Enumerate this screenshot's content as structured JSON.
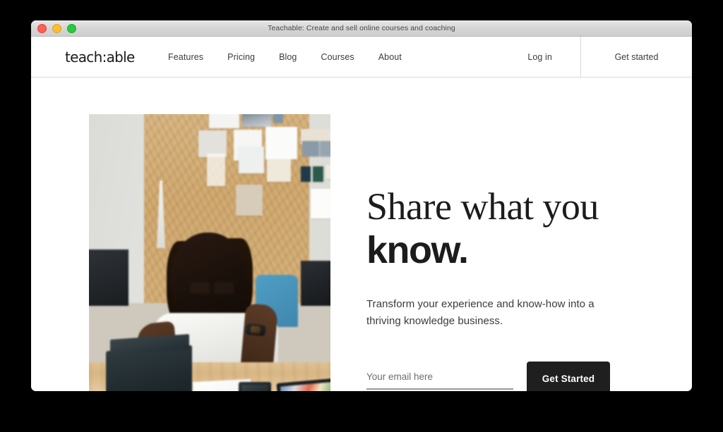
{
  "window": {
    "title": "Teachable: Create and sell online courses and coaching",
    "controls": {
      "close": "close-button",
      "minimize": "minimize-button",
      "maximize": "maximize-button"
    }
  },
  "header": {
    "logo": "teach:able",
    "nav": [
      {
        "label": "Features"
      },
      {
        "label": "Pricing"
      },
      {
        "label": "Blog"
      },
      {
        "label": "Courses"
      },
      {
        "label": "About"
      }
    ],
    "login_label": "Log in",
    "cta_label": "Get started"
  },
  "hero": {
    "headline_serif": "Share what you ",
    "headline_accent": "know.",
    "subhead": "Transform your experience and know-how into a thriving knowledge business.",
    "email_placeholder": "Your email here",
    "email_value": "",
    "submit_label": "Get Started",
    "image_alt": "person-at-desk-with-tablet"
  },
  "colors": {
    "button_dark": "#1f1f1f",
    "text_primary": "#1c1c1c",
    "text_secondary": "#3b3b3b",
    "border": "#d8d8d8",
    "page_background": "#ffffff",
    "desktop_background": "#000000",
    "traffic_red": "#ff5f57",
    "traffic_yellow": "#ffbd2e",
    "traffic_green": "#28c840"
  }
}
